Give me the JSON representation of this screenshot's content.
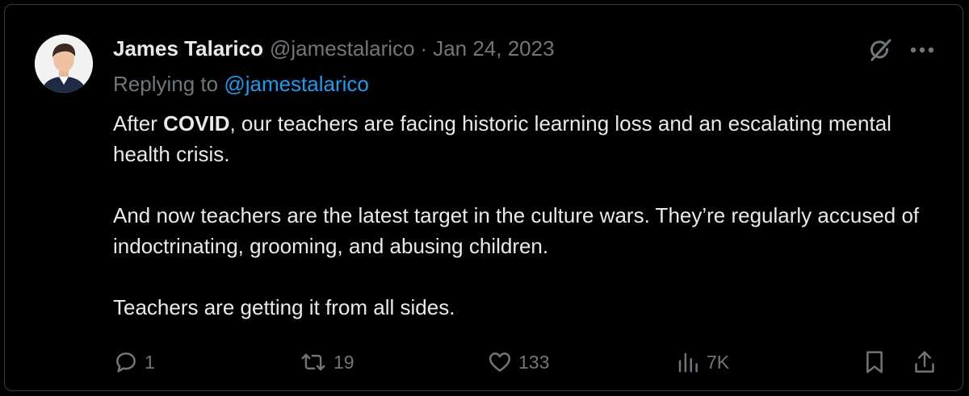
{
  "tweet": {
    "author_name": "James Talarico",
    "author_handle": "@jamestalarico",
    "separator": "·",
    "date": "Jan 24, 2023",
    "replying_prefix": "Replying to",
    "replying_handle": "@jamestalarico",
    "paragraphs": [
      {
        "pre": "After ",
        "bold": "COVID",
        "post": ", our teachers are facing historic learning loss and an escalating mental health crisis."
      },
      {
        "text": "And now teachers are the latest target in the culture wars. They’re regularly accused of indoctrinating, grooming, and abusing children."
      },
      {
        "text": "Teachers are getting it from all sides."
      }
    ]
  },
  "header_icons": [
    "grok-icon",
    "more-icon"
  ],
  "actions": {
    "replies": "1",
    "retweets": "19",
    "likes": "133",
    "views": "7K"
  },
  "colors": {
    "background": "#000000",
    "text": "#e7e9ea",
    "muted": "#71767b",
    "link": "#1d9bf0",
    "border": "#3a3d41"
  }
}
